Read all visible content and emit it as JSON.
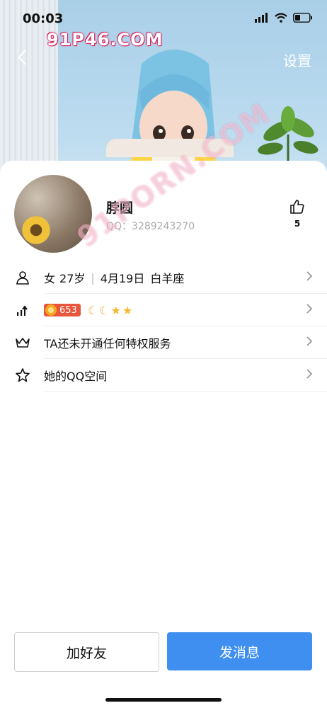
{
  "status_bar": {
    "time": "00:03"
  },
  "nav": {
    "settings_label": "设置"
  },
  "watermarks": {
    "top": "91P46.COM",
    "diagonal": "91PORN.COM"
  },
  "profile": {
    "name": "脖圆",
    "qq_label": "QQ：3289243270",
    "likes": "5"
  },
  "info_rows": {
    "basic": {
      "gender": "女",
      "age": "27岁",
      "separator": "|",
      "birthday": "4月19日",
      "zodiac": "白羊座"
    },
    "level": {
      "points": "653",
      "icons": [
        "moon-icon",
        "moon-icon",
        "star-icon",
        "star-icon"
      ]
    },
    "privilege": {
      "label": "TA还未开通任何特权服务"
    },
    "qzone": {
      "label": "她的QQ空间"
    }
  },
  "actions": {
    "add_friend": "加好友",
    "send_message": "发消息"
  },
  "colors": {
    "primary_blue": "#3e8ff0",
    "badge_red": "#e8553a"
  }
}
